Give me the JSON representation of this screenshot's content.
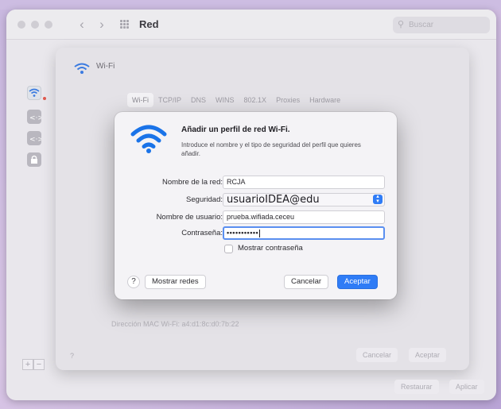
{
  "window": {
    "title": "Red",
    "search_placeholder": "Buscar"
  },
  "background_sheet": {
    "section_label": "Wi-Fi",
    "tabs": [
      {
        "label": "Wi-Fi"
      },
      {
        "label": "TCP/IP"
      },
      {
        "label": "DNS"
      },
      {
        "label": "WINS"
      },
      {
        "label": "802.1X"
      },
      {
        "label": "Proxies"
      },
      {
        "label": "Hardware"
      }
    ],
    "mac_address_label": "Dirección MAC Wi-Fi:  a4:d1:8c:d0:7b:22",
    "cancel_label": "Cancelar",
    "accept_label": "Aceptar"
  },
  "footer": {
    "restore_label": "Restaurar",
    "apply_label": "Aplicar",
    "help": "?"
  },
  "dialog": {
    "title": "Añadir un perfil de red Wi-Fi.",
    "subtitle": "Introduce el nombre y el tipo de seguridad del perfil que quieres añadir.",
    "fields": {
      "network_name": {
        "label": "Nombre de la red:",
        "value": "RCJA"
      },
      "security": {
        "label": "Seguridad:",
        "value": "usuarioIDEA@edu"
      },
      "username": {
        "label": "Nombre de usuario:",
        "value": "prueba.wifiada.ceceu"
      },
      "password": {
        "label": "Contraseña:",
        "value": "•••••••••••"
      }
    },
    "show_password_label": "Mostrar contraseña",
    "show_networks_label": "Mostrar redes",
    "cancel_label": "Cancelar",
    "accept_label": "Aceptar",
    "help": "?"
  },
  "colors": {
    "accent": "#2f7cf6",
    "wifi_icon": "#1a73e8"
  }
}
